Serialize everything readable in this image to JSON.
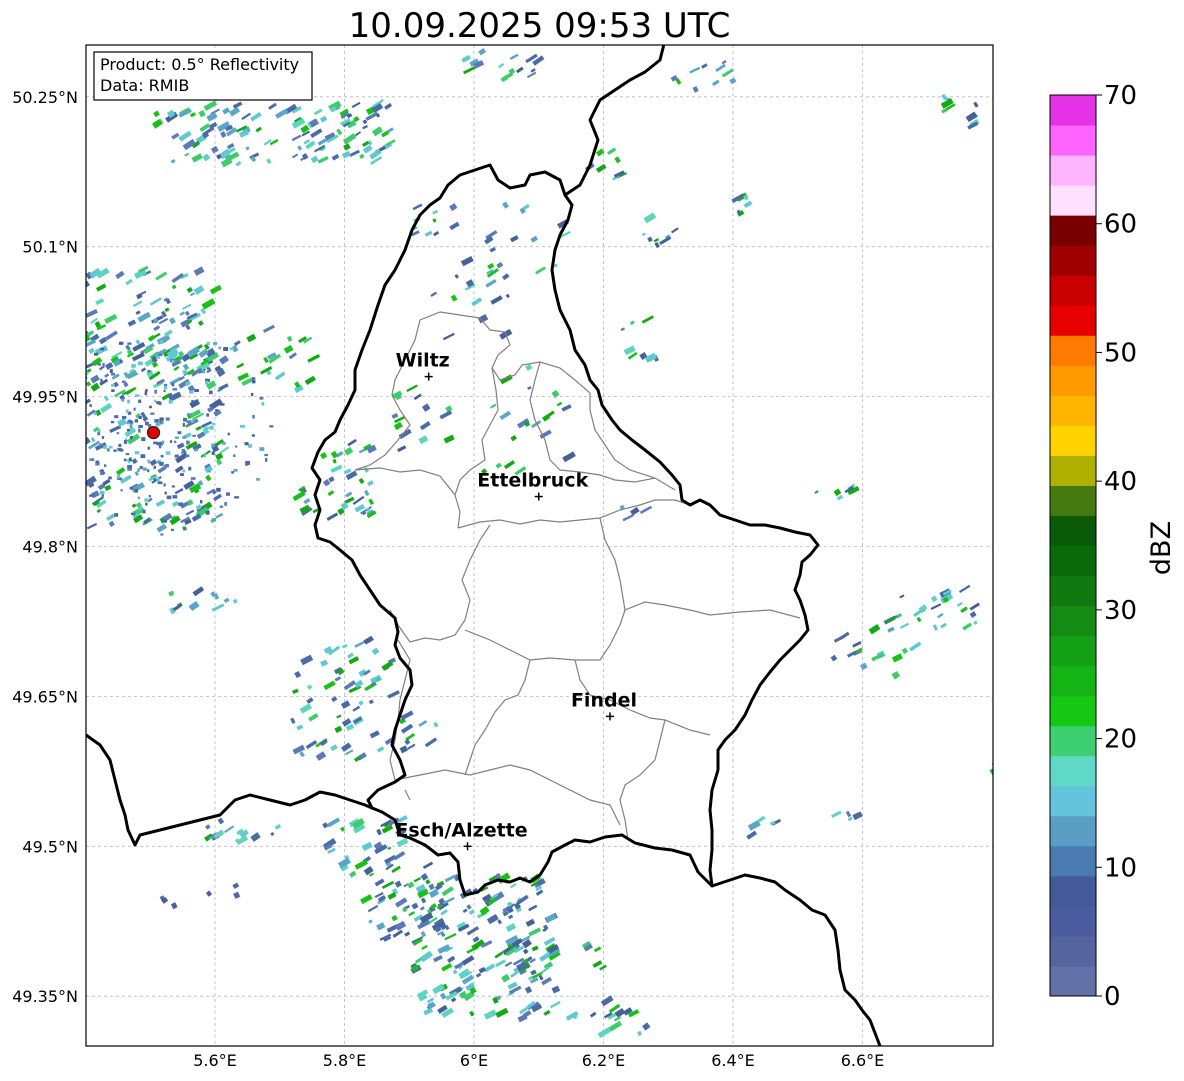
{
  "title": "10.09.2025 09:53 UTC",
  "info": {
    "product": "Product: 0.5° Reflectivity",
    "data": "Data: RMIB"
  },
  "axes": {
    "lon_ticks": [
      "5.6°E",
      "5.8°E",
      "6°E",
      "6.2°E",
      "6.4°E",
      "6.6°E"
    ],
    "lat_ticks": [
      "50.25°N",
      "50.1°N",
      "49.95°N",
      "49.8°N",
      "49.65°N",
      "49.5°N",
      "49.35°N"
    ],
    "lon_range": [
      5.4,
      6.8
    ],
    "lat_range": [
      49.3,
      50.3
    ]
  },
  "cities": [
    {
      "name": "Wiltz",
      "lon": 5.93,
      "lat": 49.97
    },
    {
      "name": "Ettelbruck",
      "lon": 6.1,
      "lat": 49.85
    },
    {
      "name": "Findel",
      "lon": 6.21,
      "lat": 49.63
    },
    {
      "name": "Esch/Alzette",
      "lon": 5.99,
      "lat": 49.5
    }
  ],
  "radar_site": {
    "lon": 5.505,
    "lat": 49.914
  },
  "colorbar": {
    "label": "dBZ",
    "ticks": [
      "0",
      "10",
      "20",
      "30",
      "40",
      "50",
      "60",
      "70"
    ],
    "range": [
      0,
      70
    ],
    "colors": [
      "#6272a8",
      "#56649e",
      "#4a5ba0",
      "#425a9a",
      "#4a7ab0",
      "#5a9ec6",
      "#64c4dc",
      "#60d8c8",
      "#3ed070",
      "#14c814",
      "#14b414",
      "#14a014",
      "#148c14",
      "#107a10",
      "#0a6a0a",
      "#0a5a0a",
      "#447a10",
      "#b0b000",
      "#ffd200",
      "#ffb400",
      "#ff9a00",
      "#ff7a00",
      "#e80000",
      "#c80000",
      "#a00000",
      "#7a0000",
      "#ffe0ff",
      "#ffb4ff",
      "#ff64ff",
      "#e632e6"
    ]
  }
}
